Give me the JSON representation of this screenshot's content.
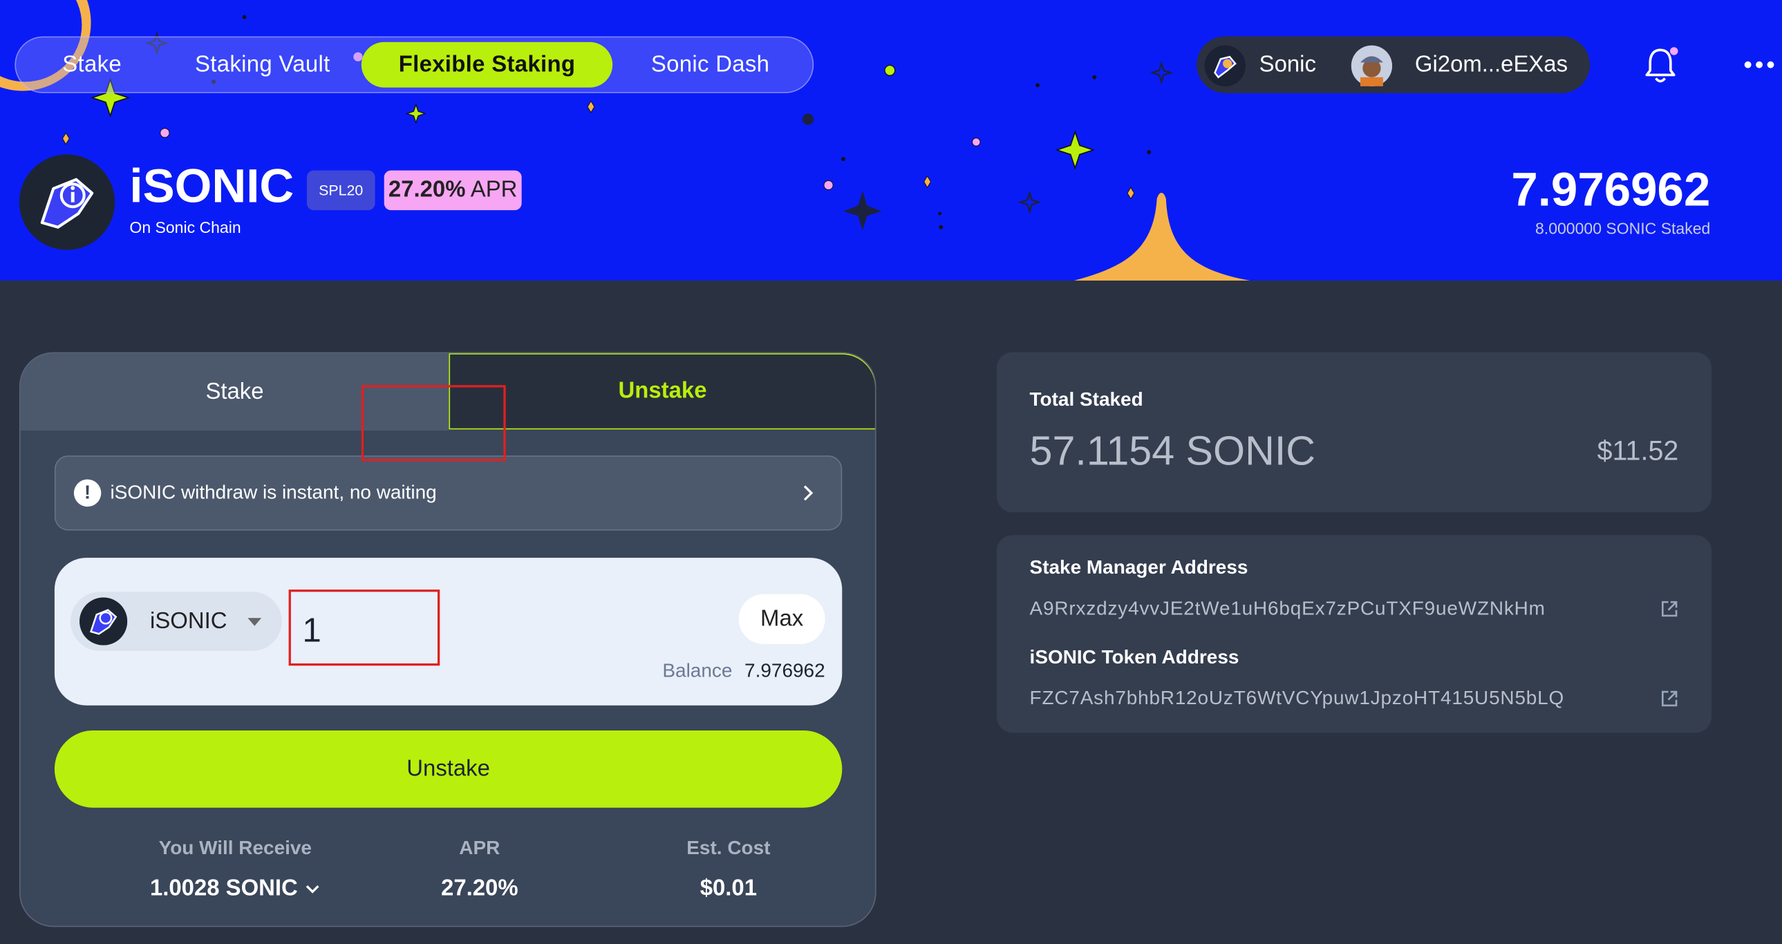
{
  "nav": {
    "items": [
      "Stake",
      "Staking Vault",
      "Flexible Staking",
      "Sonic Dash"
    ],
    "active": "Flexible Staking"
  },
  "wallet": {
    "network": "Sonic",
    "address": "Gi2om...eEXas"
  },
  "icons": {
    "bell": "bell-icon",
    "more": "more-icon",
    "info": "info-icon",
    "chevron_right": "chevron-right-icon",
    "caret": "caret-down-icon",
    "external": "external-link-icon"
  },
  "colors": {
    "banner": "#0a1cf5",
    "accent": "#b9ef0c",
    "apr_badge": "#f7a6f4",
    "card": "#3a4659",
    "page": "#2a3241"
  },
  "token": {
    "name": "iSONIC",
    "subtitle": "On Sonic Chain",
    "standard_badge": "SPL20",
    "apr_value": "27.20%",
    "apr_label": "APR",
    "balance": "7.976962",
    "staked_text": "8.000000 SONIC Staked"
  },
  "card": {
    "tabs": [
      "Stake",
      "Unstake"
    ],
    "active_tab": "Unstake",
    "notice": "iSONIC withdraw is instant, no waiting",
    "token_select": "iSONIC",
    "amount_value": "1",
    "max_label": "Max",
    "balance_label": "Balance",
    "balance_value": "7.976962",
    "action_label": "Unstake",
    "stats": [
      {
        "label": "You Will Receive",
        "value": "1.0028 SONIC"
      },
      {
        "label": "APR",
        "value": "27.20%"
      },
      {
        "label": "Est. Cost",
        "value": "$0.01"
      }
    ]
  },
  "total_staked": {
    "title": "Total Staked",
    "amount": "57.1154 SONIC",
    "usd": "$11.52"
  },
  "addresses": {
    "stake_manager_label": "Stake Manager Address",
    "stake_manager_value": "A9Rrxzdzy4vvJE2tWe1uH6bqEx7zPCuTXF9ueWZNkHm",
    "token_label": "iSONIC Token Address",
    "token_value": "FZC7Ash7bhbR12oUzT6WtVCYpuw1JpzoHT415U5N5bLQ"
  }
}
